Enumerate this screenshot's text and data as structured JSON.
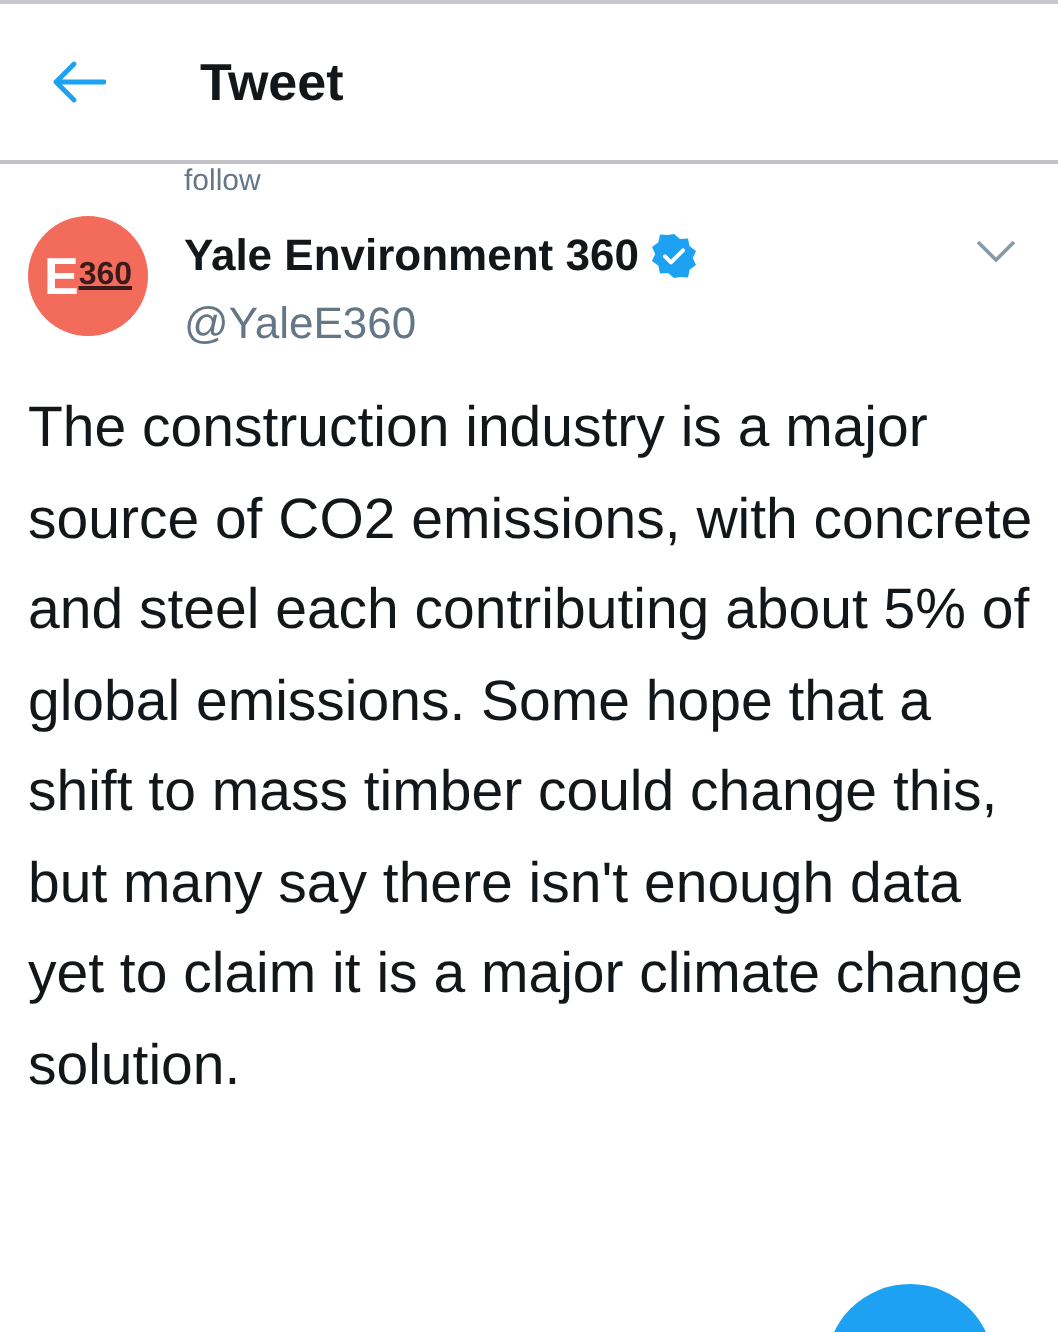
{
  "header": {
    "title": "Tweet"
  },
  "context_line": "follow",
  "author": {
    "avatar_letter": "E",
    "avatar_number": "360",
    "name": "Yale Environment 360",
    "verified": true,
    "handle": "@YaleE360"
  },
  "tweet_text": "The construction industry is a major source of CO2 emissions, with concrete and steel each contributing about 5% of global emissions. Some hope that a shift to mass timber could change this, but many say there isn't enough data yet to claim it is a major climate change solution."
}
